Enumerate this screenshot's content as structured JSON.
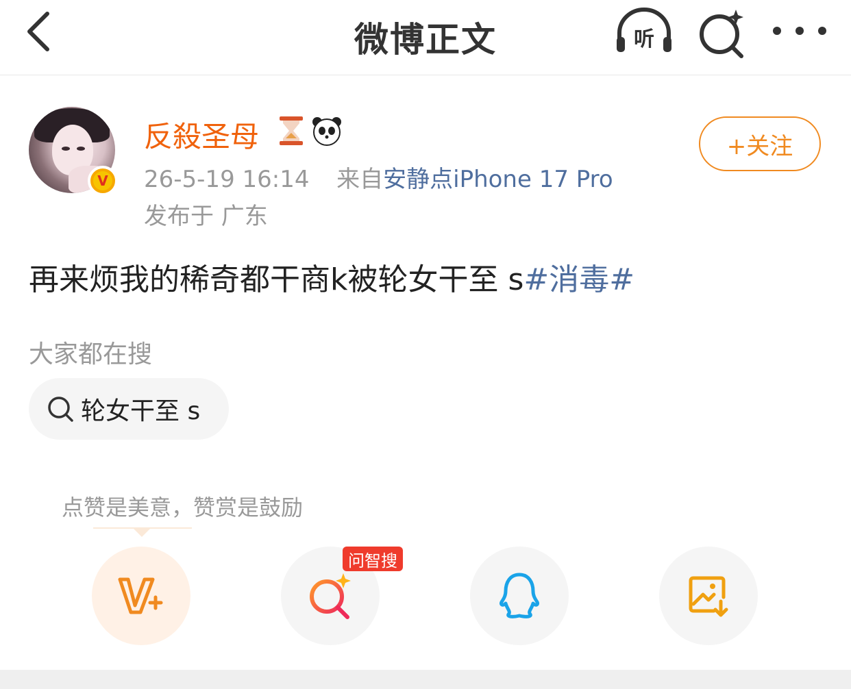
{
  "header": {
    "title": "微博正文",
    "listen_label": "听"
  },
  "author": {
    "name": "反殺圣母",
    "badge": "V",
    "emojis": [
      "hourglass",
      "panda"
    ],
    "time": "26-5-19 16:14",
    "from_prefix": "来自",
    "device": "安静点iPhone 17 Pro",
    "location": "发布于 广东",
    "follow_label": "+关注"
  },
  "post": {
    "text": "再来烦我的稀奇都干商k被轮女干至 s",
    "hashtag": "#消毒#"
  },
  "trending": {
    "label": "大家都在搜",
    "chip": "轮女干至 s"
  },
  "actions": {
    "tip": "点赞是美意，赞赏是鼓励",
    "ask_badge": "问智搜",
    "icons": [
      "v-plus-icon",
      "ai-search-icon",
      "qq-penguin-icon",
      "save-image-icon"
    ]
  },
  "colors": {
    "accent_orange": "#f08a20",
    "username": "#f0620c",
    "link_blue": "#4f6e9e",
    "badge_red": "#ef3b2c"
  }
}
